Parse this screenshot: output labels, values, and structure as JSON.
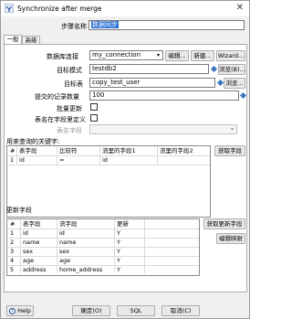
{
  "window": {
    "title": "Synchronize after merge"
  },
  "form": {
    "step_name_label": "步骤名称",
    "step_name_value": "数据同步",
    "tabs": [
      "一般",
      "高级"
    ],
    "connection_label": "数据库连接",
    "connection_value": "my_connection",
    "edit_button": "编辑...",
    "new_button": "新建...",
    "wizard_button": "Wizard...",
    "target_schema_label": "目标模式",
    "target_schema_value": "testdb2",
    "browse_schema_button": "浏览(B)...",
    "target_table_label": "目标表",
    "target_table_value": "copy_test_user",
    "browse_table_button": "浏览...",
    "commit_size_label": "提交的记录数量",
    "commit_size_value": "100",
    "batch_update_label": "批量更新",
    "table_in_field_label": "表名在字段里定义",
    "table_field_label": "表名字段"
  },
  "keys": {
    "section_label": "用来查询的关键字:",
    "get_fields_button": "获取字段",
    "headers": [
      "#",
      "表字段",
      "比较符",
      "流里的字段1",
      "流里的字段2"
    ],
    "rows": [
      [
        "1",
        "id",
        "=",
        "id",
        ""
      ]
    ]
  },
  "updates": {
    "section_label": "更新字段",
    "get_update_fields_button": "获取更新字段",
    "edit_mapping_button": "编辑映射",
    "headers": [
      "#",
      "表字段",
      "流字段",
      "更新"
    ],
    "rows": [
      [
        "1",
        "id",
        "id",
        "Y"
      ],
      [
        "2",
        "name",
        "name",
        "Y"
      ],
      [
        "3",
        "sex",
        "sex",
        "Y"
      ],
      [
        "4",
        "age",
        "age",
        "Y"
      ],
      [
        "5",
        "address",
        "home_address",
        "Y"
      ]
    ]
  },
  "footer": {
    "help_button": "Help",
    "ok_button": "确定(O)",
    "sql_button": "SQL",
    "cancel_button": "取消(C)"
  }
}
